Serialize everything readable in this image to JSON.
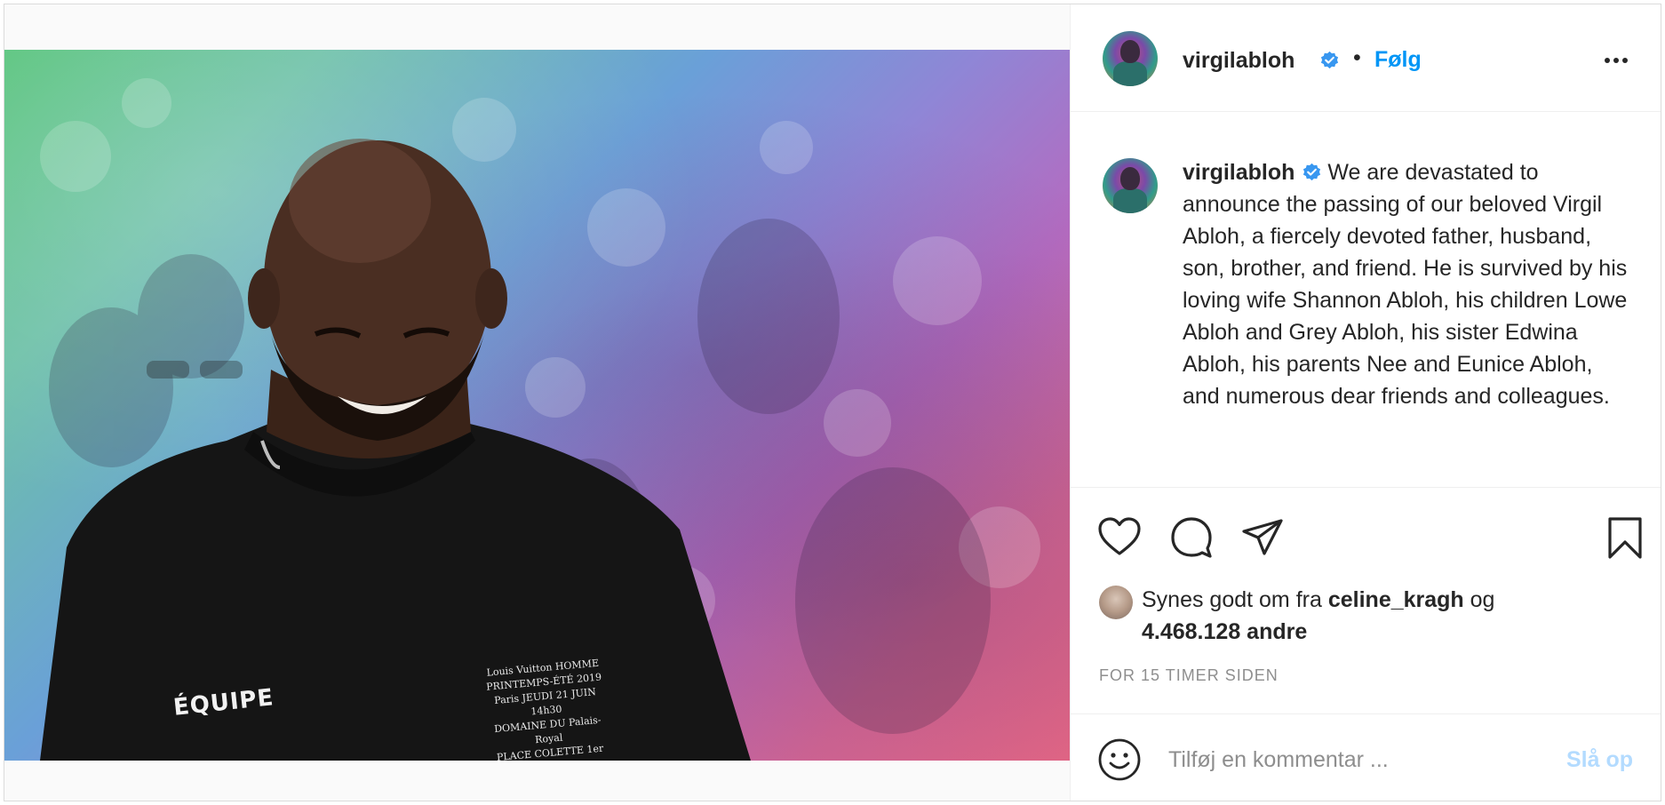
{
  "post": {
    "username": "virgilabloh",
    "verified_icon": "verified-badge-icon",
    "dot": "•",
    "follow_label": "Følg",
    "more_icon": "more-options-icon",
    "caption": "We are devastated to announce the passing of our beloved Virgil Abloh, a fiercely devoted father, husband, son, brother, and friend. He is survived by his loving wife Shannon Abloh, his children Lowe Abloh and Grey Abloh, his sister Edwina Abloh, his parents Nee and Eunice Abloh, and numerous dear friends and colleagues."
  },
  "image": {
    "shirt_text": "ÉQUIPE",
    "shirt_print": [
      "Louis Vuitton HOMME",
      "PRINTEMPS-ÉTÉ 2019",
      "Paris JEUDI 21 JUIN 14h30",
      "DOMAINE DU Palais-Royal",
      "PLACE COLETTE 1er"
    ]
  },
  "actions": {
    "like_icon": "heart-icon",
    "comment_icon": "comment-icon",
    "share_icon": "paper-plane-icon",
    "save_icon": "bookmark-icon"
  },
  "likes": {
    "prefix": "Synes godt om fra",
    "liker": "celine_kragh",
    "conjunction": "og",
    "others": "4.468.128 andre"
  },
  "timestamp": "FOR 15 TIMER SIDEN",
  "comment": {
    "placeholder": "Tilføj en kommentar ...",
    "post_label": "Slå op",
    "emoji_icon": "smiley-icon"
  },
  "colors": {
    "link_blue": "#0095f6",
    "post_disabled": "#b3dbff",
    "muted": "#8e8e8e"
  }
}
